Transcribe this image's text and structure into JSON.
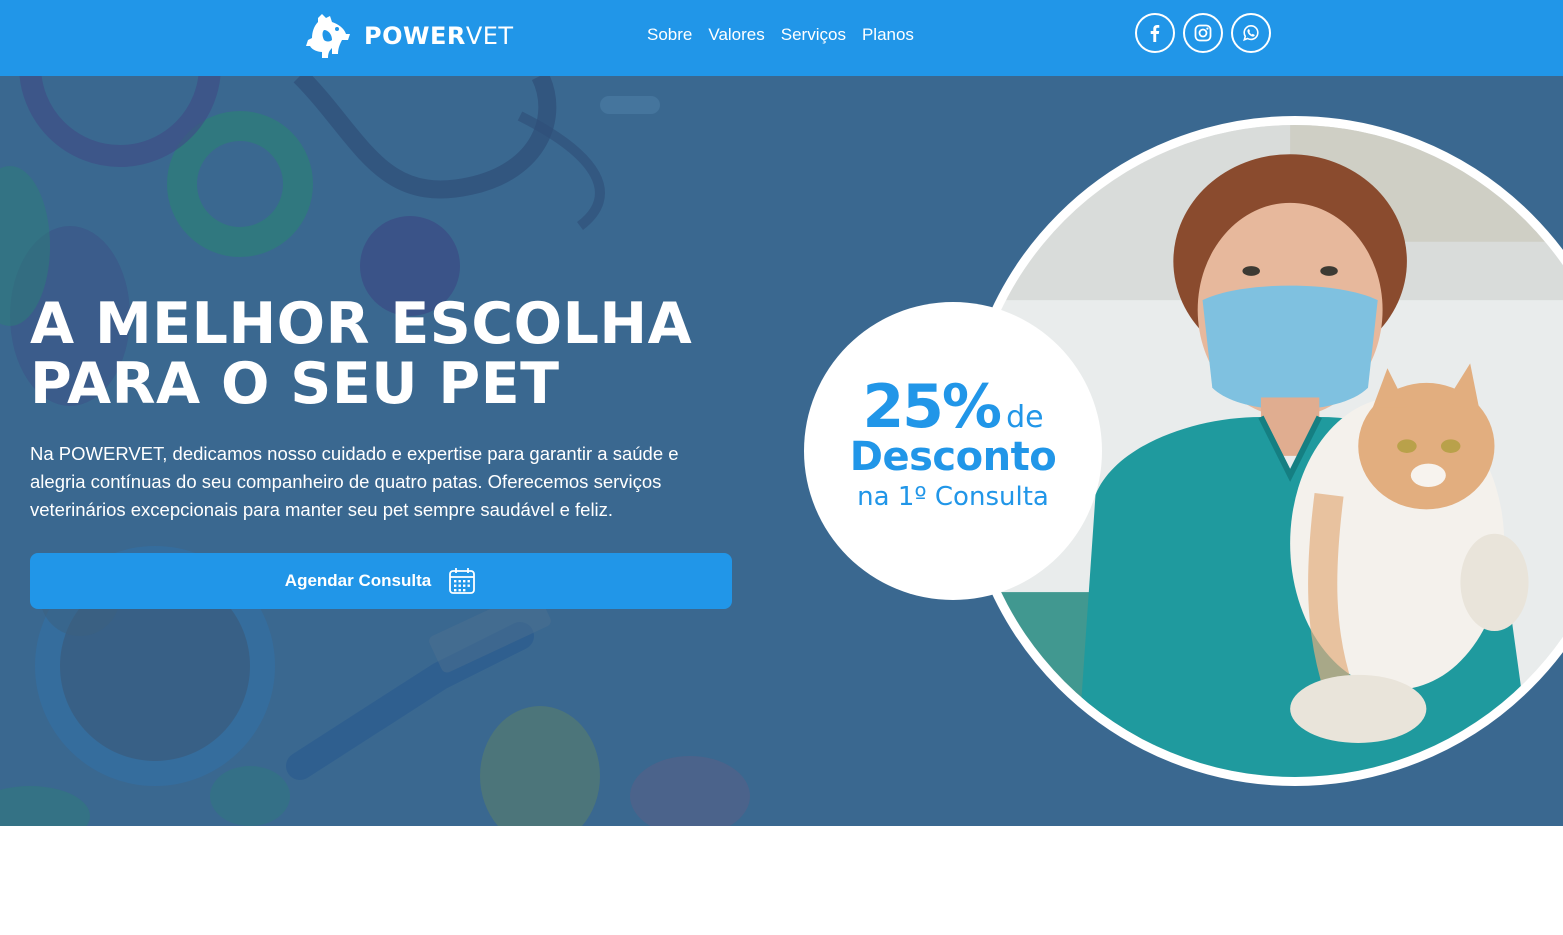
{
  "brand": {
    "name_bold": "POWER",
    "name_light": "VET",
    "color": "#2196e8",
    "hero_overlay": "#3a6890",
    "logo_icon": "dog-cat-silhouette-icon"
  },
  "nav": {
    "items": [
      {
        "label": "Sobre"
      },
      {
        "label": "Valores"
      },
      {
        "label": "Serviços"
      },
      {
        "label": "Planos"
      }
    ]
  },
  "social": {
    "icons": [
      "facebook-icon",
      "instagram-icon",
      "whatsapp-icon"
    ]
  },
  "hero": {
    "title_line1": "A MELHOR ESCOLHA",
    "title_line2": "PARA O SEU PET",
    "description": "Na POWERVET, dedicamos nosso cuidado e expertise para garantir a saúde e alegria contínuas do seu companheiro de quatro patas. Oferecemos serviços veterinários excepcionais para manter seu pet sempre saudável e feliz.",
    "cta_label": "Agendar Consulta",
    "cta_icon": "calendar-icon"
  },
  "promo": {
    "percent": "25%",
    "de": "de",
    "desconto": "Desconto",
    "consulta": "na 1º Consulta"
  }
}
